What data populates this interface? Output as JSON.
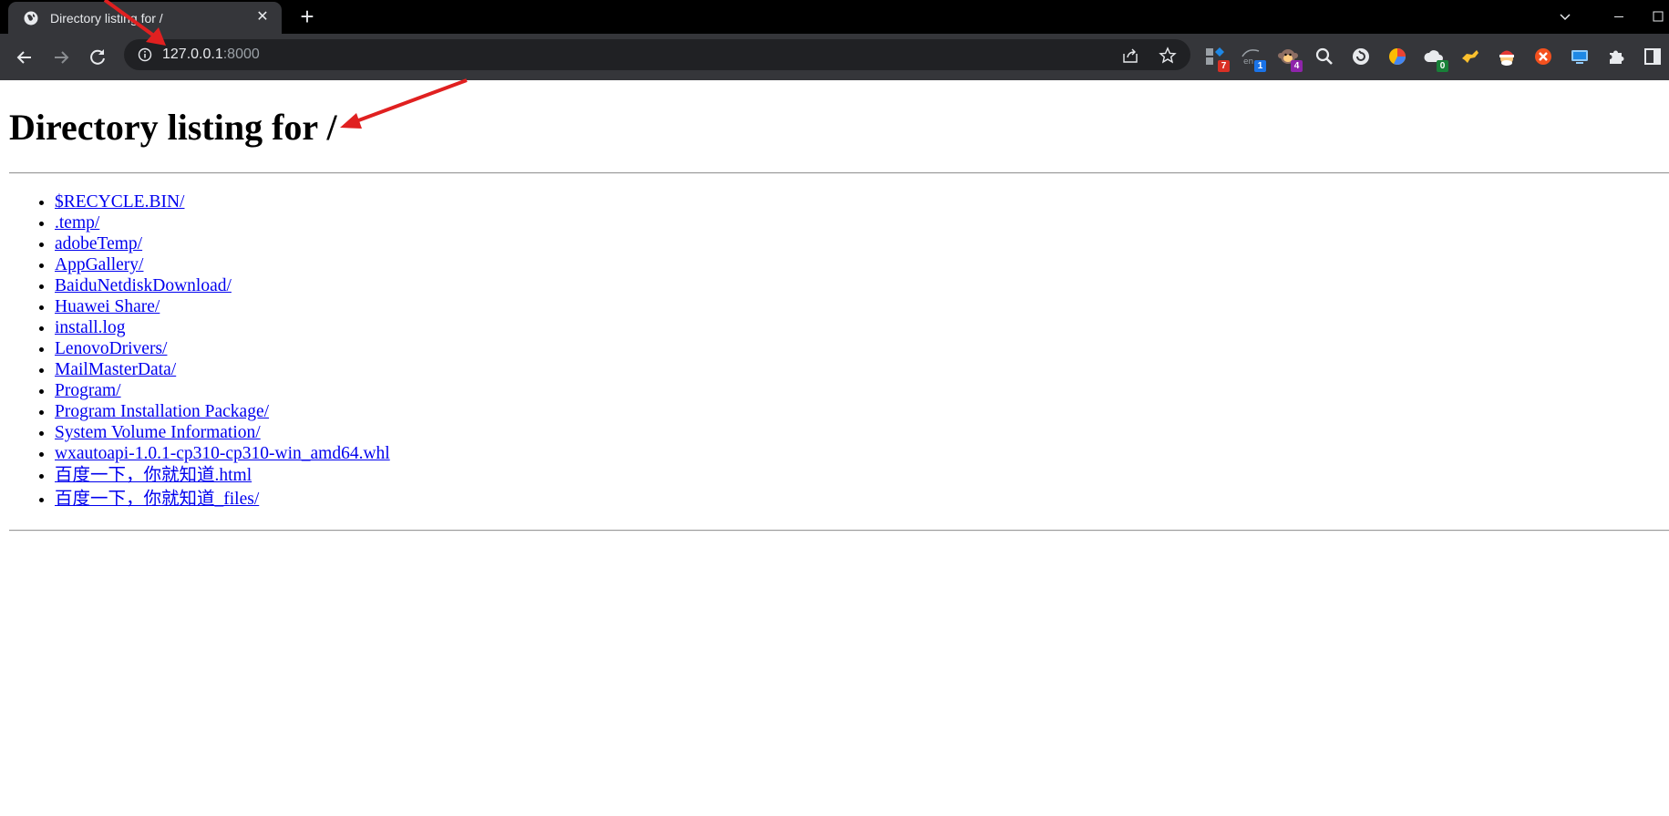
{
  "browser": {
    "tab": {
      "title": "Directory listing for /",
      "close": "✕"
    },
    "new_tab": "+",
    "address": {
      "host": "127.0.0.1",
      "port": ":8000"
    },
    "extensions": [
      {
        "icon": "grid-extension-icon",
        "badge": "7",
        "badge_color": "#d93025"
      },
      {
        "icon": "translate-extension-icon",
        "badge": "1",
        "badge_color": "#1a73e8"
      },
      {
        "icon": "monkey-extension-icon",
        "badge": "4",
        "badge_color": "#8e24aa"
      },
      {
        "icon": "magnifier-extension-icon"
      },
      {
        "icon": "refresh-circle-extension-icon"
      },
      {
        "icon": "pie-chart-extension-icon"
      },
      {
        "icon": "cloud-extension-icon",
        "badge": "0",
        "badge_color": "#188038"
      },
      {
        "icon": "fox-extension-icon"
      },
      {
        "icon": "santa-extension-icon"
      },
      {
        "icon": "orange-circle-extension-icon"
      },
      {
        "icon": "screen-extension-icon"
      },
      {
        "icon": "puzzle-icon"
      },
      {
        "icon": "sidebar-icon"
      }
    ]
  },
  "page": {
    "heading": "Directory listing for /",
    "entries": [
      {
        "label": "$RECYCLE.BIN/"
      },
      {
        "label": ".temp/"
      },
      {
        "label": "adobeTemp/"
      },
      {
        "label": "AppGallery/"
      },
      {
        "label": "BaiduNetdiskDownload/"
      },
      {
        "label": "Huawei Share/"
      },
      {
        "label": "install.log"
      },
      {
        "label": "LenovoDrivers/"
      },
      {
        "label": "MailMasterData/"
      },
      {
        "label": "Program/"
      },
      {
        "label": "Program Installation Package/"
      },
      {
        "label": "System Volume Information/"
      },
      {
        "label": "wxautoapi-1.0.1-cp310-cp310-win_amd64.whl"
      },
      {
        "label": "百度一下，你就知道.html"
      },
      {
        "label": "百度一下，你就知道_files/"
      }
    ]
  },
  "colors": {
    "link": "#0000ee",
    "annotation_arrow": "#e02020",
    "chrome_dark": "#35363a"
  }
}
